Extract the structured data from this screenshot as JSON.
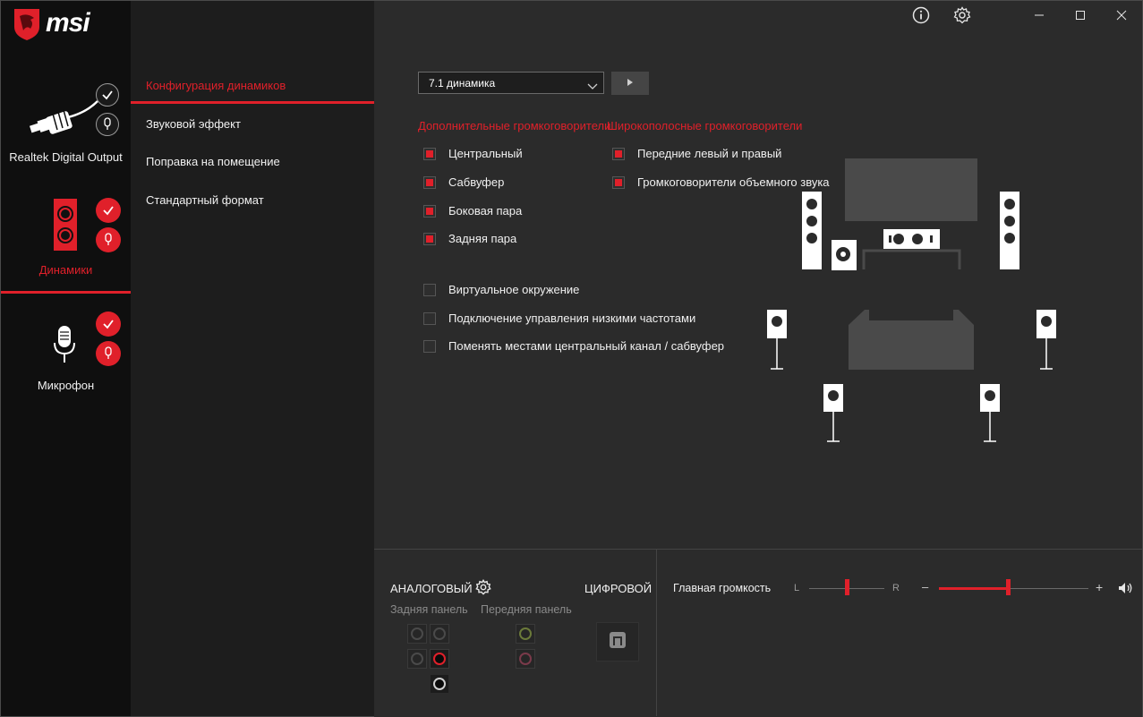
{
  "brand": {
    "logo_text": "msi"
  },
  "window": {
    "info_icon": "info-icon",
    "settings_icon": "gear-icon"
  },
  "devices": [
    {
      "label": "Realtek Digital Output",
      "icon": "optical-cable-icon",
      "active": false
    },
    {
      "label": "Динамики",
      "icon": "speaker-icon",
      "active": true
    },
    {
      "label": "Микрофон",
      "icon": "microphone-icon",
      "active": false
    }
  ],
  "nav": {
    "items": [
      "Конфигурация динамиков",
      "Звуковой эффект",
      "Поправка на помещение",
      "Стандартный формат"
    ],
    "active_index": 0
  },
  "config": {
    "dropdown_value": "7.1 динамика",
    "extra_title": "Дополнительные громкоговорители",
    "wide_title": "Широкополосные громкоговорители",
    "extra_items": [
      {
        "label": "Центральный",
        "checked": true
      },
      {
        "label": "Сабвуфер",
        "checked": true
      },
      {
        "label": "Боковая пара",
        "checked": true
      },
      {
        "label": "Задняя пара",
        "checked": true
      }
    ],
    "wide_items": [
      {
        "label": "Передние левый и правый",
        "checked": true
      },
      {
        "label": "Громкоговорители объемного звука",
        "checked": true
      }
    ],
    "options": [
      {
        "label": "Виртуальное окружение",
        "checked": false
      },
      {
        "label": "Подключение управления низкими частотами",
        "checked": false
      },
      {
        "label": "Поменять местами центральный канал / сабвуфер",
        "checked": false
      }
    ]
  },
  "bottom": {
    "analog_label": "АНАЛОГОВЫЙ",
    "digital_label": "ЦИФРОВОЙ",
    "rear_panel": "Задняя панель",
    "front_panel": "Передняя панель",
    "main_volume": "Главная громкость",
    "balance_left": "L",
    "balance_right": "R",
    "minus": "–",
    "plus": "+",
    "balance_value": 0.5,
    "volume_value": 0.46
  },
  "colors": {
    "accent": "#e0202a",
    "bg": "#2b2b2b",
    "sidebar": "#0f0f0f",
    "nav": "#1d1d1d"
  }
}
